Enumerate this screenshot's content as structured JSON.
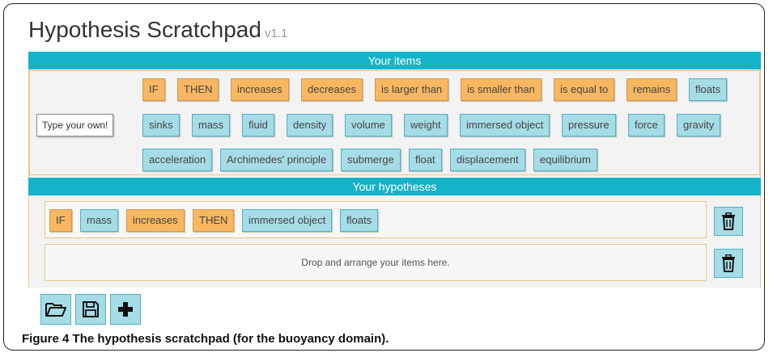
{
  "app": {
    "title": "Hypothesis Scratchpad",
    "version": "v1.1"
  },
  "items_section": {
    "header": "Your items",
    "type_your_own": "Type your own!"
  },
  "items": [
    {
      "label": "IF",
      "kind": "logic"
    },
    {
      "label": "THEN",
      "kind": "logic"
    },
    {
      "label": "increases",
      "kind": "logic"
    },
    {
      "label": "decreases",
      "kind": "logic"
    },
    {
      "label": "is larger than",
      "kind": "logic"
    },
    {
      "label": "is smaller than",
      "kind": "logic"
    },
    {
      "label": "is equal to",
      "kind": "logic"
    },
    {
      "label": "remains",
      "kind": "logic"
    },
    {
      "label": "floats",
      "kind": "concept"
    },
    {
      "label": "sinks",
      "kind": "concept"
    },
    {
      "label": "mass",
      "kind": "concept"
    },
    {
      "label": "fluid",
      "kind": "concept"
    },
    {
      "label": "density",
      "kind": "concept"
    },
    {
      "label": "volume",
      "kind": "concept"
    },
    {
      "label": "weight",
      "kind": "concept"
    },
    {
      "label": "immersed object",
      "kind": "concept"
    },
    {
      "label": "pressure",
      "kind": "concept"
    },
    {
      "label": "force",
      "kind": "concept"
    },
    {
      "label": "gravity",
      "kind": "concept"
    },
    {
      "label": "acceleration",
      "kind": "concept"
    },
    {
      "label": "Archimedes' principle",
      "kind": "concept"
    },
    {
      "label": "submerge",
      "kind": "concept"
    },
    {
      "label": "float",
      "kind": "concept"
    },
    {
      "label": "displacement",
      "kind": "concept"
    },
    {
      "label": "equilibrium",
      "kind": "concept"
    }
  ],
  "hypotheses_section": {
    "header": "Your hypotheses"
  },
  "hypotheses": [
    {
      "items": [
        {
          "label": "IF",
          "kind": "logic"
        },
        {
          "label": "mass",
          "kind": "concept"
        },
        {
          "label": "increases",
          "kind": "logic"
        },
        {
          "label": "THEN",
          "kind": "logic"
        },
        {
          "label": "immersed object",
          "kind": "concept"
        },
        {
          "label": "floats",
          "kind": "concept"
        }
      ]
    },
    {
      "placeholder": "Drop and arrange your items here.",
      "items": []
    }
  ],
  "toolbar": [
    {
      "icon": "folder-open-icon"
    },
    {
      "icon": "save-icon"
    },
    {
      "icon": "plus-icon"
    }
  ],
  "caption": {
    "label": "Figure 4",
    "text": "The hypothesis scratchpad (for the buoyancy domain)."
  },
  "colors": {
    "header_bar": "#15b3c8",
    "logic_chip": "#f8b760",
    "concept_chip": "#a6dce6"
  }
}
